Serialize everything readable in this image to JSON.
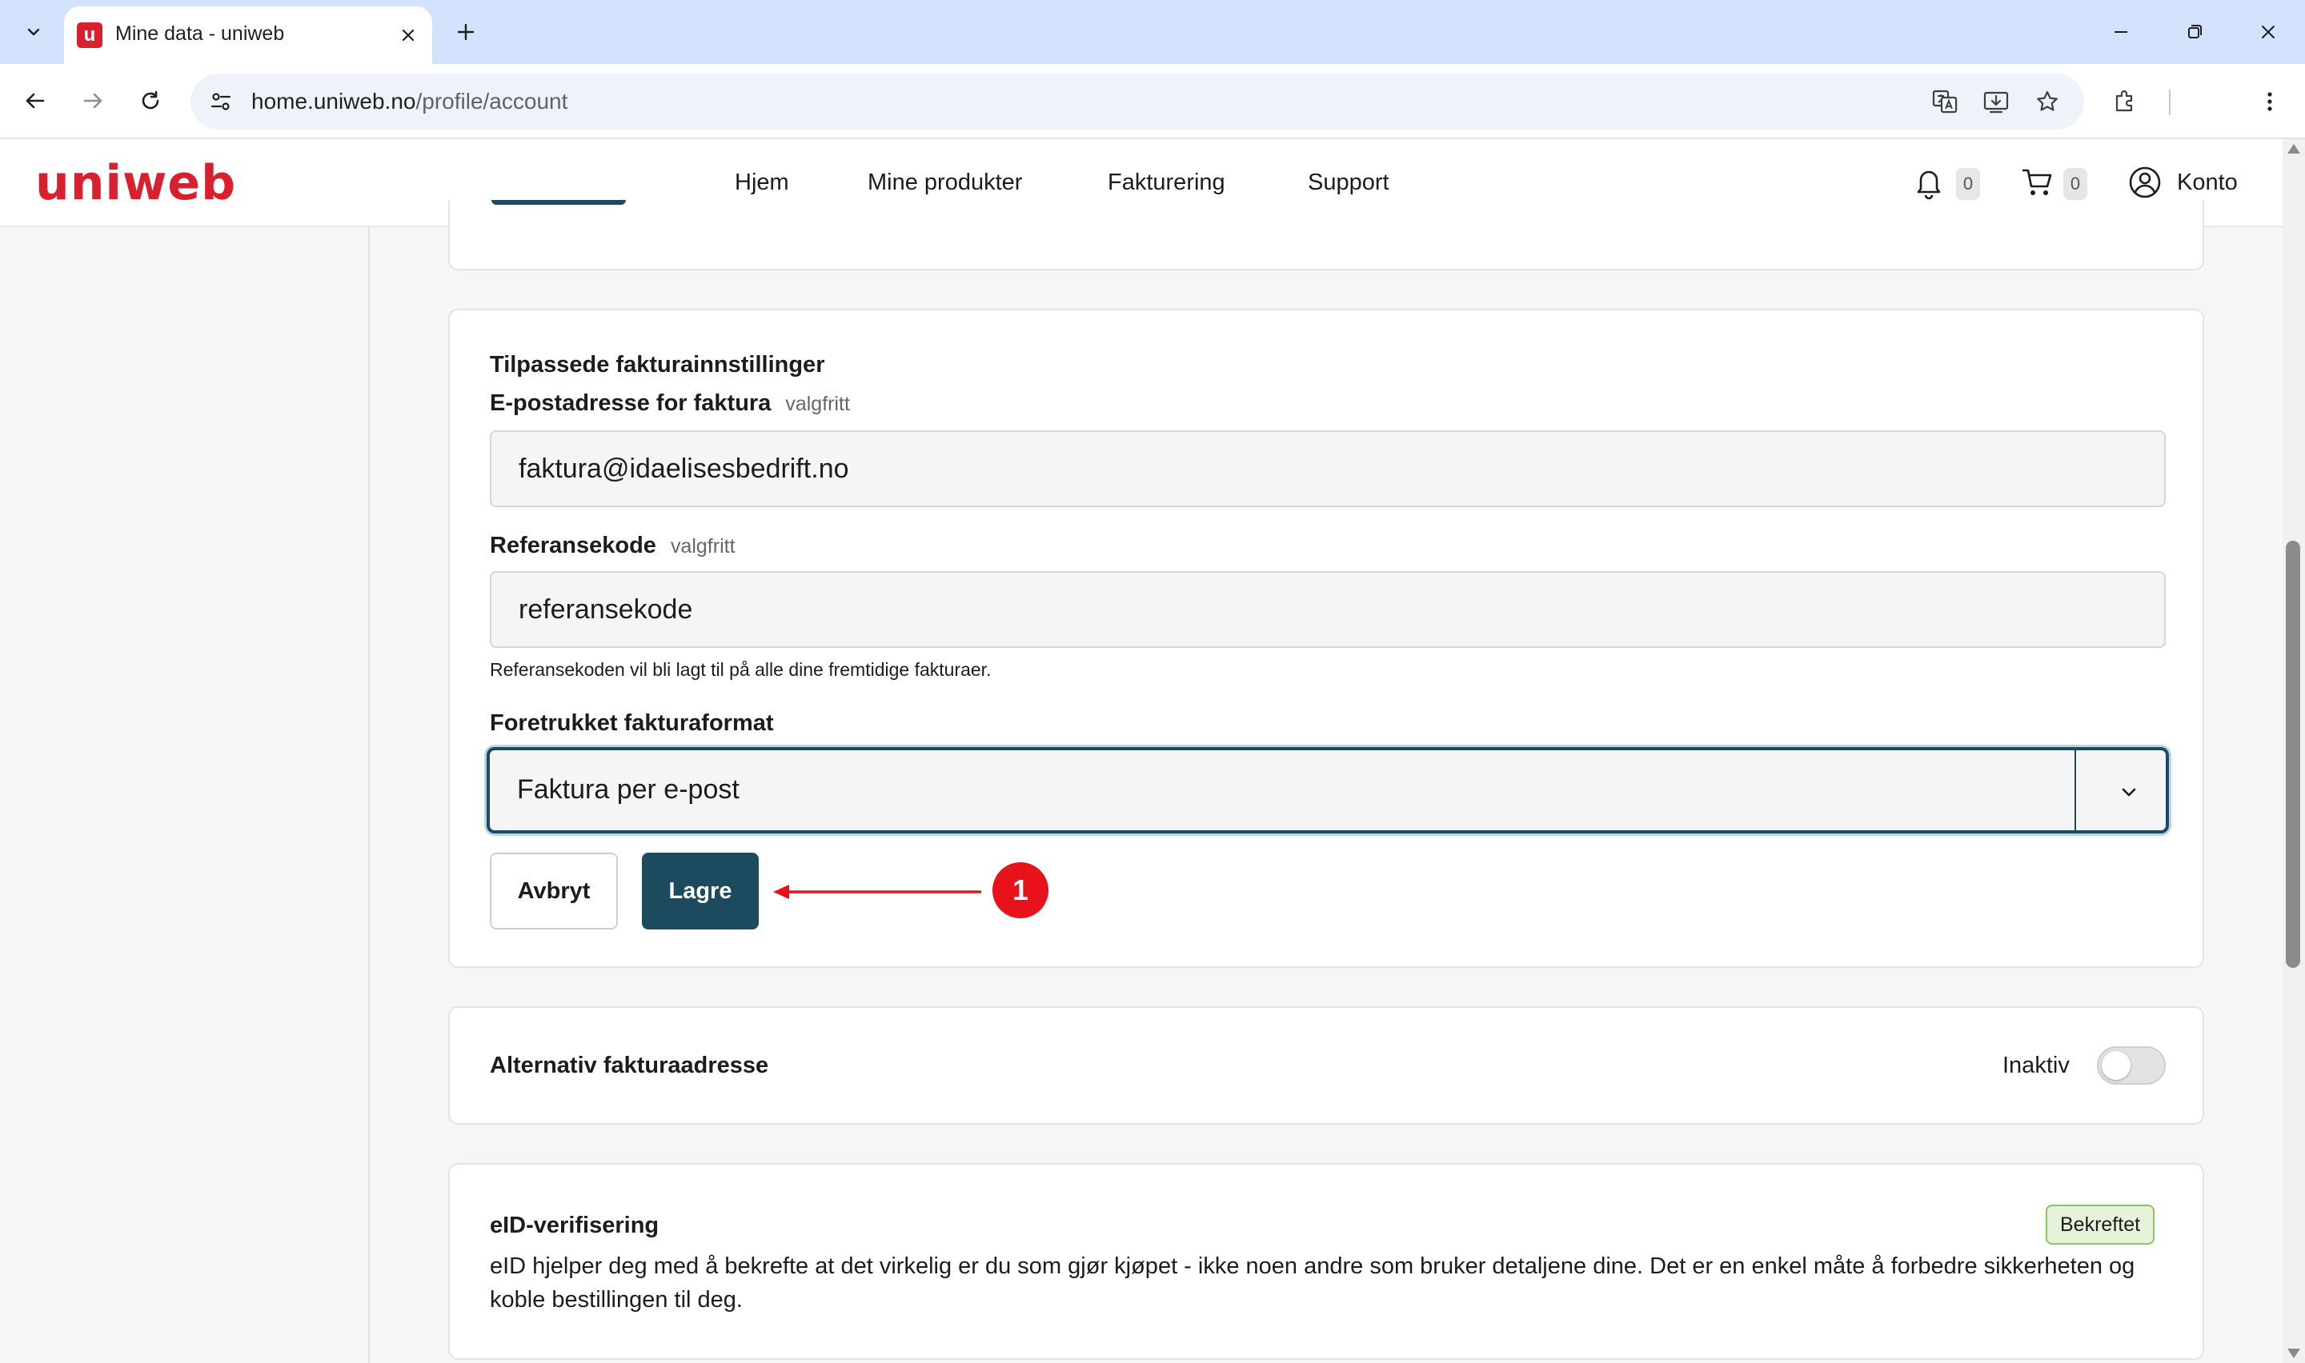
{
  "browser": {
    "tab_title": "Mine data - uniweb",
    "favicon_letter": "u",
    "url_host": "home.uniweb.no",
    "url_path": "/profile/account"
  },
  "site": {
    "logo": "uniweb",
    "nav": [
      "Hjem",
      "Mine produkter",
      "Fakturering",
      "Support"
    ],
    "notification_count": "0",
    "cart_count": "0",
    "account_label": "Konto",
    "brand_color": "#d8202e"
  },
  "invoice_settings": {
    "heading": "Tilpassede fakturainnstillinger",
    "email_label": "E-postadresse for faktura",
    "email_optional": "valgfritt",
    "email_value": "faktura@idaelisesbedrift.no",
    "reference_label": "Referansekode",
    "reference_optional": "valgfritt",
    "reference_value": "referansekode",
    "reference_help": "Referansekoden vil bli lagt til på alle dine fremtidige fakturaer.",
    "format_label": "Foretrukket fakturaformat",
    "format_value": "Faktura per e-post",
    "cancel_label": "Avbryt",
    "save_label": "Lagre",
    "save_color": "#1c4a5f"
  },
  "annotation": {
    "number": "1",
    "color": "#e8121b"
  },
  "alt_address": {
    "title": "Alternativ fakturaadresse",
    "status": "Inaktiv",
    "enabled": false
  },
  "eid": {
    "title": "eID-verifisering",
    "badge": "Bekreftet",
    "description": "eID hjelper deg med å bekrefte at det virkelig er du som gjør kjøpet - ikke noen andre som bruker detaljene dine. Det er en enkel måte å forbedre sikkerheten og koble bestillingen til deg."
  }
}
